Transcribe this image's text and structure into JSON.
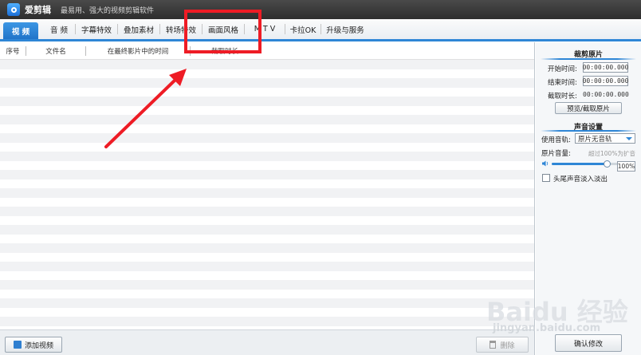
{
  "app": {
    "name": "爱剪辑",
    "slogan": "最易用、强大的视频剪辑软件"
  },
  "tabs": [
    {
      "label": "视 频",
      "active": true
    },
    {
      "label": "音 频"
    },
    {
      "label": "字幕特效"
    },
    {
      "label": "叠加素材"
    },
    {
      "label": "转场特效"
    },
    {
      "label": "画面风格"
    },
    {
      "label": "M T V"
    },
    {
      "label": "卡拉OK"
    },
    {
      "label": "升级与服务"
    }
  ],
  "list": {
    "columns": [
      "序号",
      "文件名",
      "在最终影片中的时间",
      "截取时长"
    ]
  },
  "bottom": {
    "add_label": "添加视频",
    "delete_label": "删除"
  },
  "panel": {
    "crop_title": "裁剪原片",
    "start_label": "开始时间:",
    "start_value": "00:00:00.000",
    "end_label": "结束时间:",
    "end_value": "00:00:00.000",
    "duration_label": "截取时长:",
    "duration_value": "00:00:00.000",
    "preview_button": "预览/截取原片",
    "audio_title": "声音设置",
    "track_label": "使用音轨:",
    "track_value": "原片无音轨",
    "volume_label": "原片音量:",
    "volume_hint": "超过100%为扩音",
    "volume_value": "100%",
    "volume_level": 0.67,
    "fade_label": "头尾声音淡入淡出",
    "confirm_button": "确认修改"
  },
  "watermark": {
    "text": "Baidu 经验",
    "sub": "jingyan.baidu.com"
  },
  "colors": {
    "accent": "#2e86d6",
    "annotation": "#ee1c25"
  }
}
